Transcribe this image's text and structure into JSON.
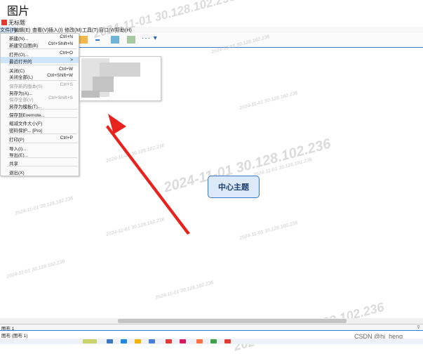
{
  "window": {
    "title": "图片"
  },
  "app": {
    "name": "无标题"
  },
  "menubar": {
    "items": [
      {
        "label": "文件(F)"
      },
      {
        "label": "编辑(E)"
      },
      {
        "label": "查看(V)"
      },
      {
        "label": "插入(I)"
      },
      {
        "label": "修改(M)"
      },
      {
        "label": "工具(T)"
      },
      {
        "label": "窗口(W)"
      },
      {
        "label": "帮助(H)"
      }
    ]
  },
  "file_menu": {
    "items": [
      {
        "label": "新建(N)...",
        "shortcut": "Ctrl+N"
      },
      {
        "label": "新建空白图(B)",
        "shortcut": "Ctrl+Shift+N"
      },
      {
        "label": "打开(O)...",
        "shortcut": "Ctrl+O"
      },
      {
        "label": "最近打开的",
        "shortcut": ">"
      },
      {
        "label": "关闭(C)",
        "shortcut": "Ctrl+W"
      },
      {
        "label": "关闭全部(L)",
        "shortcut": "Ctrl+Shift+W"
      },
      {
        "label": "保存新的版本(S)",
        "shortcut": "Ctrl+S"
      },
      {
        "label": "另存为(A)...",
        "shortcut": ""
      },
      {
        "label": "保存全部(V)",
        "shortcut": "Ctrl+Shift+S"
      },
      {
        "label": "另存为模板(T)...",
        "shortcut": ""
      },
      {
        "label": "保存到Evernote...",
        "shortcut": ""
      },
      {
        "label": "缩减文件大小(F)",
        "shortcut": ""
      },
      {
        "label": "密码保护... [Pro]",
        "shortcut": ""
      },
      {
        "label": "打印(P)",
        "shortcut": "Ctrl+P"
      },
      {
        "label": "导入(I)...",
        "shortcut": ""
      },
      {
        "label": "导出(E)...",
        "shortcut": ""
      },
      {
        "label": "共享",
        "shortcut": ""
      },
      {
        "label": "退出(X)",
        "shortcut": ""
      }
    ]
  },
  "canvas": {
    "central_topic": "中心主题",
    "watermark_text": "2024-11-01 30.128.102.236",
    "arrow_color": "#e8231d"
  },
  "tabs": {
    "sheet": "图布 1"
  },
  "status": {
    "text": "图布 (图布 1)"
  },
  "watermark_csdn": "CSDN @hi_heng",
  "colors": {
    "accent": "#3a7ad0",
    "highlight": "#cde4fb",
    "topic_fill": "#dbe9f8"
  }
}
